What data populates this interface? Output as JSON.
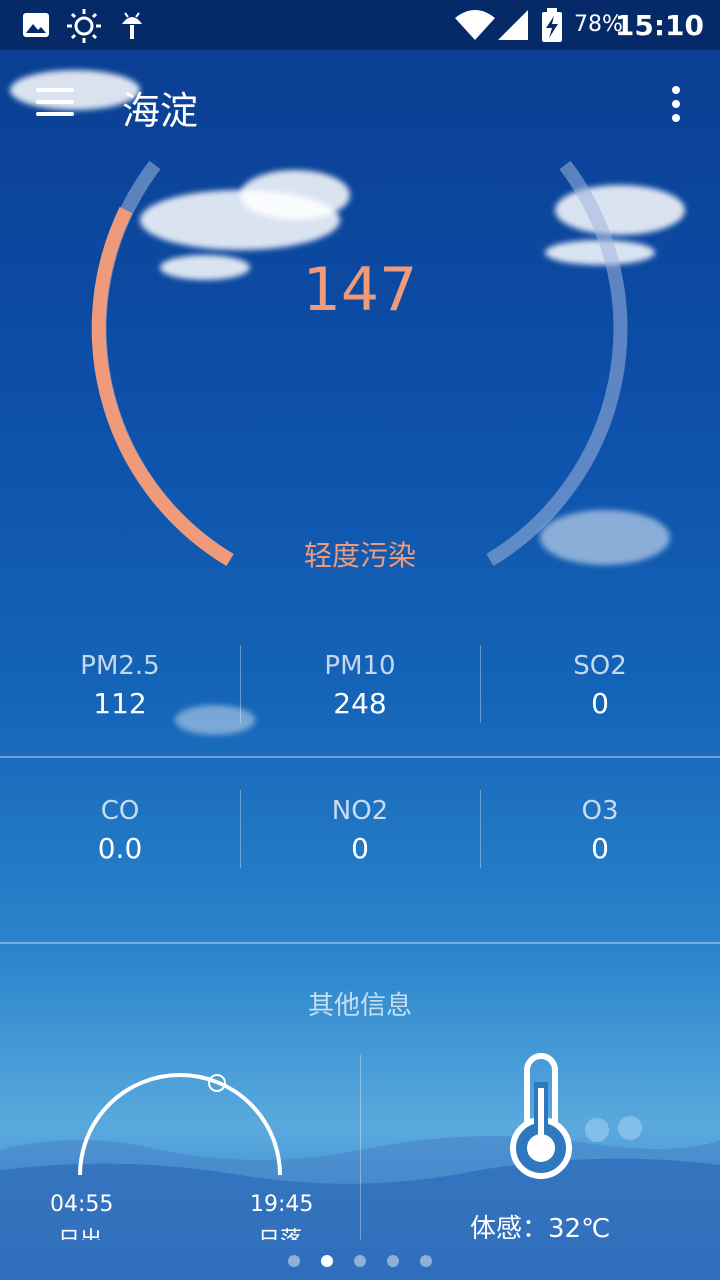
{
  "status_bar": {
    "battery_percent": "78%",
    "time": "15:10",
    "icons": [
      "image-icon",
      "brightness-icon",
      "android-icon",
      "wifi-icon",
      "signal-icon",
      "battery-charging-icon"
    ]
  },
  "toolbar": {
    "title": "海淀"
  },
  "aqi": {
    "value": "147",
    "level": "轻度污染",
    "accent_color": "#ef9a7a"
  },
  "pollutants": [
    {
      "name": "PM2.5",
      "value": "112"
    },
    {
      "name": "PM10",
      "value": "248"
    },
    {
      "name": "SO2",
      "value": "0"
    },
    {
      "name": "CO",
      "value": "0.0"
    },
    {
      "name": "NO2",
      "value": "0"
    },
    {
      "name": "O3",
      "value": "0"
    }
  ],
  "other_info": {
    "title": "其他信息",
    "sunrise_time": "04:55",
    "sunrise_label": "日出",
    "sunset_time": "19:45",
    "sunset_label": "日落",
    "feels_like": "体感：32℃"
  },
  "pager": {
    "count": 5,
    "active_index": 1
  }
}
